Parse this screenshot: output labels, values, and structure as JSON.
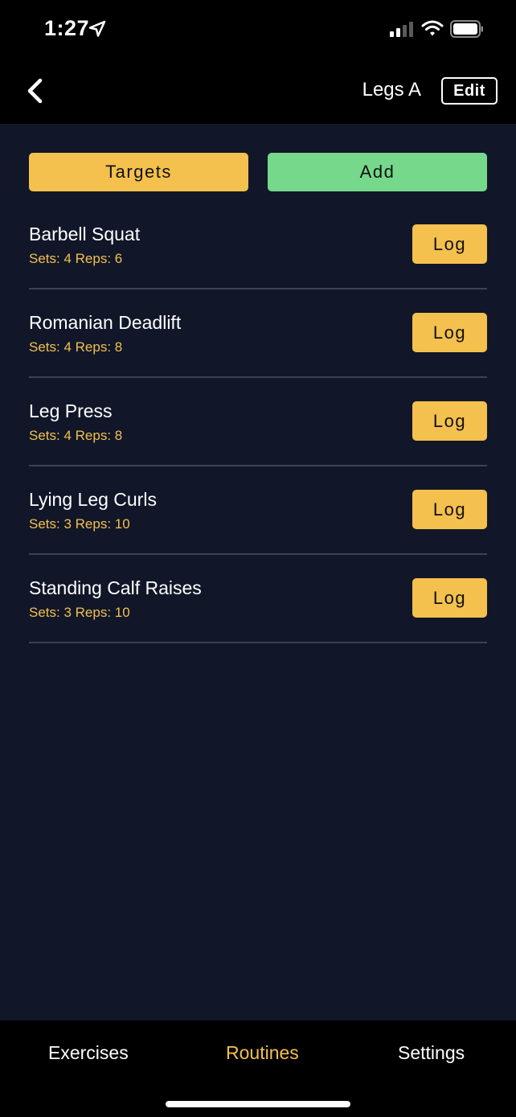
{
  "status_bar": {
    "time": "1:27",
    "icons": [
      "location-arrow-icon",
      "cellular-signal-icon",
      "wifi-icon",
      "battery-icon"
    ]
  },
  "nav": {
    "back_icon": "chevron-left-icon",
    "title": "Legs A",
    "edit_label": "Edit"
  },
  "actions": {
    "targets_label": "Targets",
    "add_label": "Add"
  },
  "exercises": [
    {
      "name": "Barbell Squat",
      "meta": "Sets: 4 Reps: 6",
      "log_label": "Log"
    },
    {
      "name": "Romanian Deadlift",
      "meta": "Sets: 4 Reps: 8",
      "log_label": "Log"
    },
    {
      "name": "Leg Press",
      "meta": "Sets: 4 Reps: 8",
      "log_label": "Log"
    },
    {
      "name": "Lying Leg Curls",
      "meta": "Sets: 3 Reps: 10",
      "log_label": "Log"
    },
    {
      "name": "Standing Calf Raises",
      "meta": "Sets: 3 Reps: 10",
      "log_label": "Log"
    }
  ],
  "tabs": {
    "exercises": "Exercises",
    "routines": "Routines",
    "settings": "Settings",
    "active": "Routines"
  },
  "colors": {
    "background": "#111729",
    "bar_background": "#000000",
    "accent_yellow": "#f4c04e",
    "accent_green": "#76d88a",
    "divider": "#3c4252"
  }
}
